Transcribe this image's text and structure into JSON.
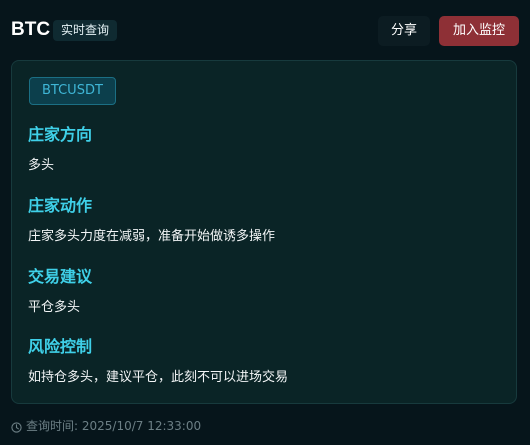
{
  "header": {
    "title": "BTC",
    "badge": "实时查询",
    "share_label": "分享",
    "monitor_label": "加入监控"
  },
  "card": {
    "symbol": "BTCUSDT",
    "sections": [
      {
        "title": "庄家方向",
        "body": "多头"
      },
      {
        "title": "庄家动作",
        "body": "庄家多头力度在减弱，准备开始做诱多操作"
      },
      {
        "title": "交易建议",
        "body": "平仓多头"
      },
      {
        "title": "风险控制",
        "body": "如持仓多头，建议平仓，此刻不可以进场交易"
      }
    ]
  },
  "footer": {
    "icon": "clock-icon",
    "query_time_text": "查询时间: 2025/10/7 12:33:00"
  },
  "colors": {
    "background": "#06151b",
    "card": "#0a2426",
    "accent": "#3fd0e8",
    "monitor_button": "#8e3036",
    "symbol_tag": "#0c3f4c"
  }
}
